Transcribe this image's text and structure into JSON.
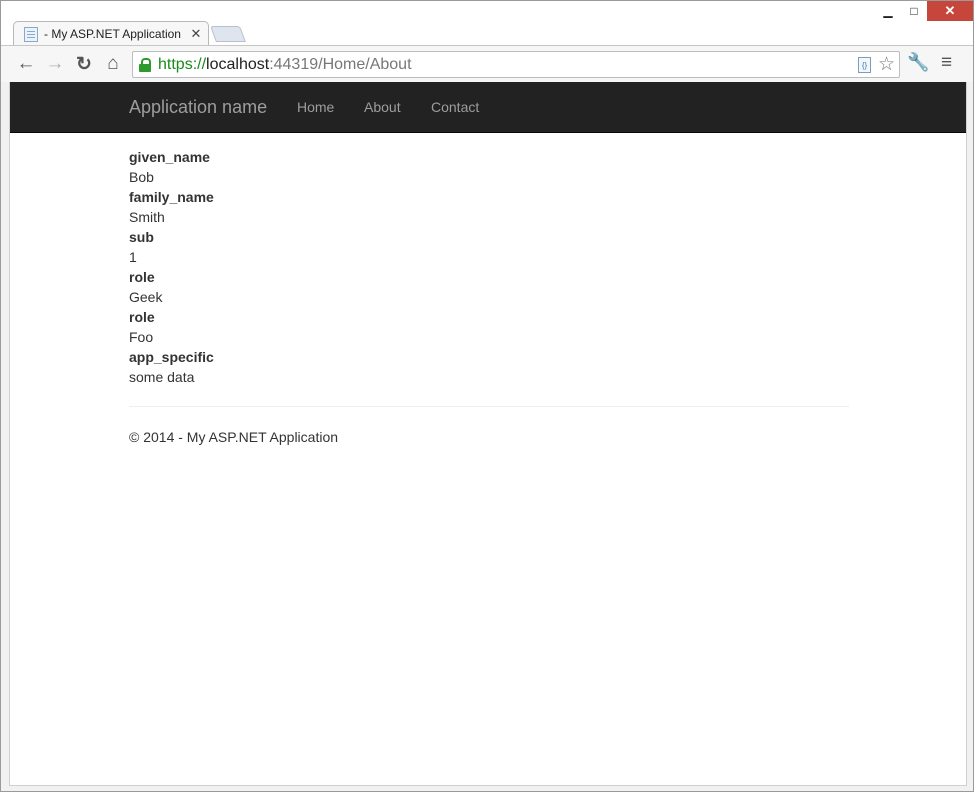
{
  "browser": {
    "tab_title": "- My ASP.NET Application",
    "url": {
      "scheme": "https",
      "separator": "://",
      "host": "localhost",
      "rest": ":44319/Home/About"
    },
    "icons": {
      "back": "arrow-left",
      "forward": "arrow-right",
      "reload": "circular-arrow",
      "home": "house",
      "lock": "padlock",
      "page_action": "document-code",
      "bookmark": "star",
      "wrench": "wrench",
      "menu": "hamburger"
    }
  },
  "navbar": {
    "brand": "Application name",
    "links": [
      "Home",
      "About",
      "Contact"
    ]
  },
  "claims": [
    {
      "type": "given_name",
      "value": "Bob"
    },
    {
      "type": "family_name",
      "value": "Smith"
    },
    {
      "type": "sub",
      "value": "1"
    },
    {
      "type": "role",
      "value": "Geek"
    },
    {
      "type": "role",
      "value": "Foo"
    },
    {
      "type": "app_specific",
      "value": "some data"
    }
  ],
  "footer": {
    "text": "© 2014 - My ASP.NET Application"
  },
  "colors": {
    "navbar_bg": "#222222",
    "navbar_text": "#9d9d9d",
    "secure_green": "#1a8c1a",
    "close_button": "#c7463c"
  }
}
